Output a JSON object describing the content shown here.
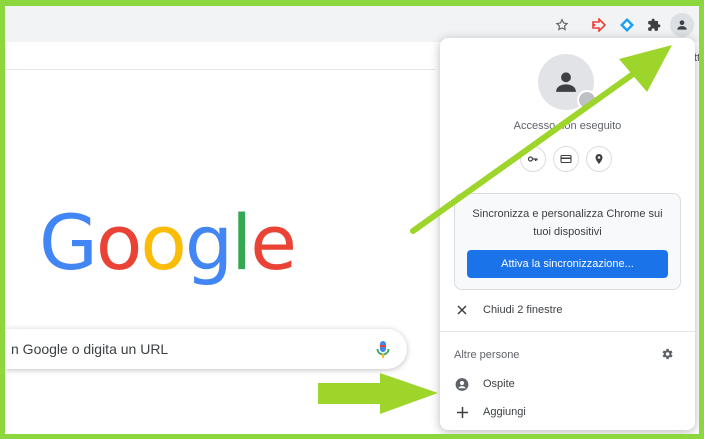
{
  "omnibox": {
    "bookmarks_overflow": "tt"
  },
  "toolbar": {
    "icons": [
      "star-icon",
      "extension-arrow-icon",
      "extension-diamond-icon",
      "puzzle-icon",
      "profile-avatar-icon"
    ]
  },
  "newtab": {
    "logo_letters": [
      "G",
      "o",
      "o",
      "g",
      "l",
      "e"
    ],
    "logo_colors": [
      "#4285F4",
      "#EA4335",
      "#FBBC05",
      "#4285F4",
      "#34A853",
      "#EA4335"
    ],
    "search_placeholder": "n Google o digita un URL"
  },
  "profile_menu": {
    "status": "Accesso non eseguito",
    "quick_icons": [
      "key-icon",
      "credit-card-icon",
      "location-pin-icon"
    ],
    "sync_text": "Sincronizza e personalizza Chrome sui tuoi dispositivi",
    "sync_button": "Attiva la sincronizzazione...",
    "close_windows": "Chiudi 2 finestre",
    "other_people_label": "Altre persone",
    "guest": "Ospite",
    "add": "Aggiungi"
  },
  "colors": {
    "accent": "#1a73e8",
    "annotation_green": "#8cd63e",
    "arrow_green": "#9ed52a"
  }
}
